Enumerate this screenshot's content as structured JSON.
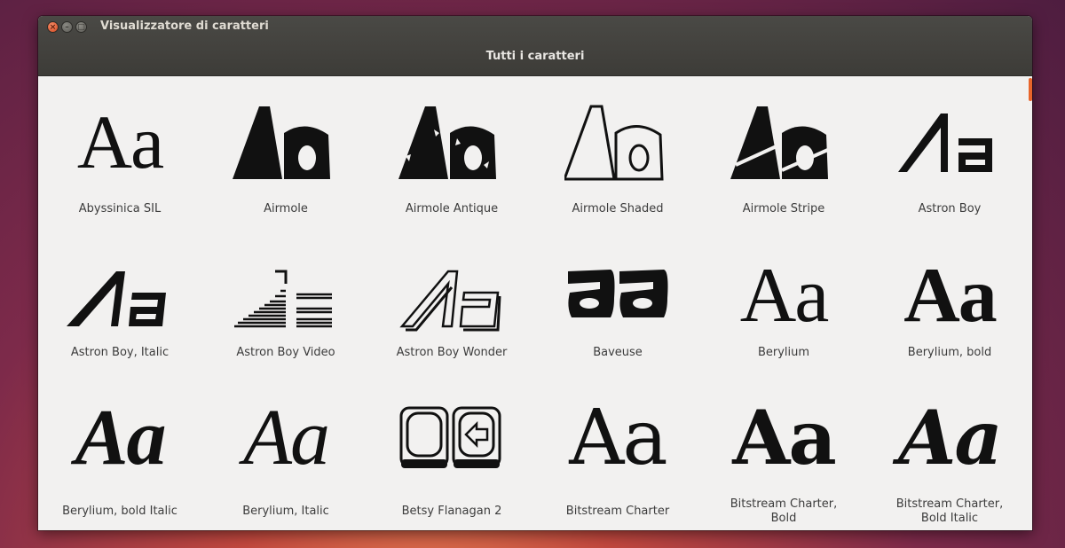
{
  "window": {
    "title": "Visualizzatore di caratteri",
    "header_title": "Tutti i caratteri",
    "accent_color": "#e8652b"
  },
  "fonts": [
    {
      "name": "Abyssinica SIL",
      "sample": "Aa"
    },
    {
      "name": "Airmole",
      "sample": "Aa"
    },
    {
      "name": "Airmole Antique",
      "sample": "Aa"
    },
    {
      "name": "Airmole Shaded",
      "sample": "Aa"
    },
    {
      "name": "Airmole Stripe",
      "sample": "Aa"
    },
    {
      "name": "Astron Boy",
      "sample": "Aa"
    },
    {
      "name": "Astron Boy, Italic",
      "sample": "Aa"
    },
    {
      "name": "Astron Boy Video",
      "sample": "Aa"
    },
    {
      "name": "Astron Boy Wonder",
      "sample": "Aa"
    },
    {
      "name": "Baveuse",
      "sample": "aa"
    },
    {
      "name": "Berylium",
      "sample": "Aa"
    },
    {
      "name": "Berylium, bold",
      "sample": "Aa"
    },
    {
      "name": "Berylium, bold Italic",
      "sample": "Aa"
    },
    {
      "name": "Berylium, Italic",
      "sample": "Aa"
    },
    {
      "name": "Betsy Flanagan 2",
      "sample": "Aa"
    },
    {
      "name": "Bitstream Charter",
      "sample": "Aa"
    },
    {
      "name": "Bitstream Charter, Bold",
      "sample": "Aa"
    },
    {
      "name": "Bitstream Charter, Bold Italic",
      "sample": "Aa"
    }
  ]
}
